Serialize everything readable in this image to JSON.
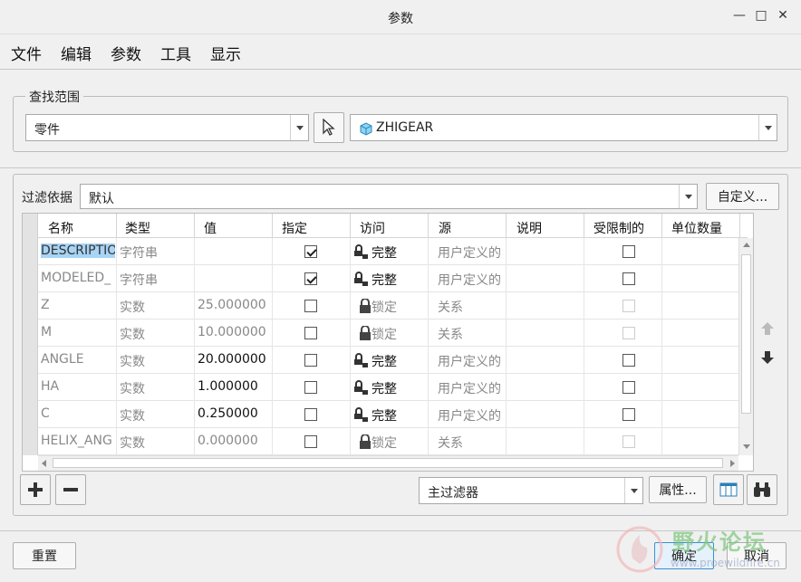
{
  "window": {
    "title": "参数"
  },
  "menu": [
    "文件",
    "编辑",
    "参数",
    "工具",
    "显示"
  ],
  "scope": {
    "label": "查找范围",
    "type_value": "零件",
    "model_value": "ZHIGEAR"
  },
  "filter": {
    "label": "过滤依据",
    "value": "默认",
    "customize_label": "自定义..."
  },
  "table": {
    "columns": [
      "名称",
      "类型",
      "值",
      "指定",
      "访问",
      "源",
      "说明",
      "受限制的",
      "单位数量"
    ],
    "rows": [
      {
        "name": "DESCRIPTIO",
        "type": "字符串",
        "value": "",
        "designated": true,
        "access": "完整",
        "source": "用户定义的",
        "restricted": false,
        "restricted_disabled": false,
        "value_dark": false,
        "access_locked": false
      },
      {
        "name": "MODELED_",
        "type": "字符串",
        "value": "",
        "designated": true,
        "access": "完整",
        "source": "用户定义的",
        "restricted": false,
        "restricted_disabled": false,
        "value_dark": false,
        "access_locked": false
      },
      {
        "name": "Z",
        "type": "实数",
        "value": "25.000000",
        "designated": false,
        "access": "锁定",
        "source": "关系",
        "restricted": false,
        "restricted_disabled": true,
        "value_dark": false,
        "access_locked": true
      },
      {
        "name": "M",
        "type": "实数",
        "value": "10.000000",
        "designated": false,
        "access": "锁定",
        "source": "关系",
        "restricted": false,
        "restricted_disabled": true,
        "value_dark": false,
        "access_locked": true
      },
      {
        "name": "ANGLE",
        "type": "实数",
        "value": "20.000000",
        "designated": false,
        "access": "完整",
        "source": "用户定义的",
        "restricted": false,
        "restricted_disabled": false,
        "value_dark": true,
        "access_locked": false
      },
      {
        "name": "HA",
        "type": "实数",
        "value": "1.000000",
        "designated": false,
        "access": "完整",
        "source": "用户定义的",
        "restricted": false,
        "restricted_disabled": false,
        "value_dark": true,
        "access_locked": false
      },
      {
        "name": "C",
        "type": "实数",
        "value": "0.250000",
        "designated": false,
        "access": "完整",
        "source": "用户定义的",
        "restricted": false,
        "restricted_disabled": false,
        "value_dark": true,
        "access_locked": false
      },
      {
        "name": "HELIX_ANG",
        "type": "实数",
        "value": "0.000000",
        "designated": false,
        "access": "锁定",
        "source": "关系",
        "restricted": false,
        "restricted_disabled": true,
        "value_dark": false,
        "access_locked": true
      }
    ]
  },
  "bottom": {
    "main_filter": "主过滤器",
    "properties_label": "属性...",
    "reset_label": "重置",
    "ok_label": "确定",
    "cancel_label": "取消"
  },
  "watermark": {
    "text": "野火论坛",
    "url": "www.proewildfire.cn"
  }
}
